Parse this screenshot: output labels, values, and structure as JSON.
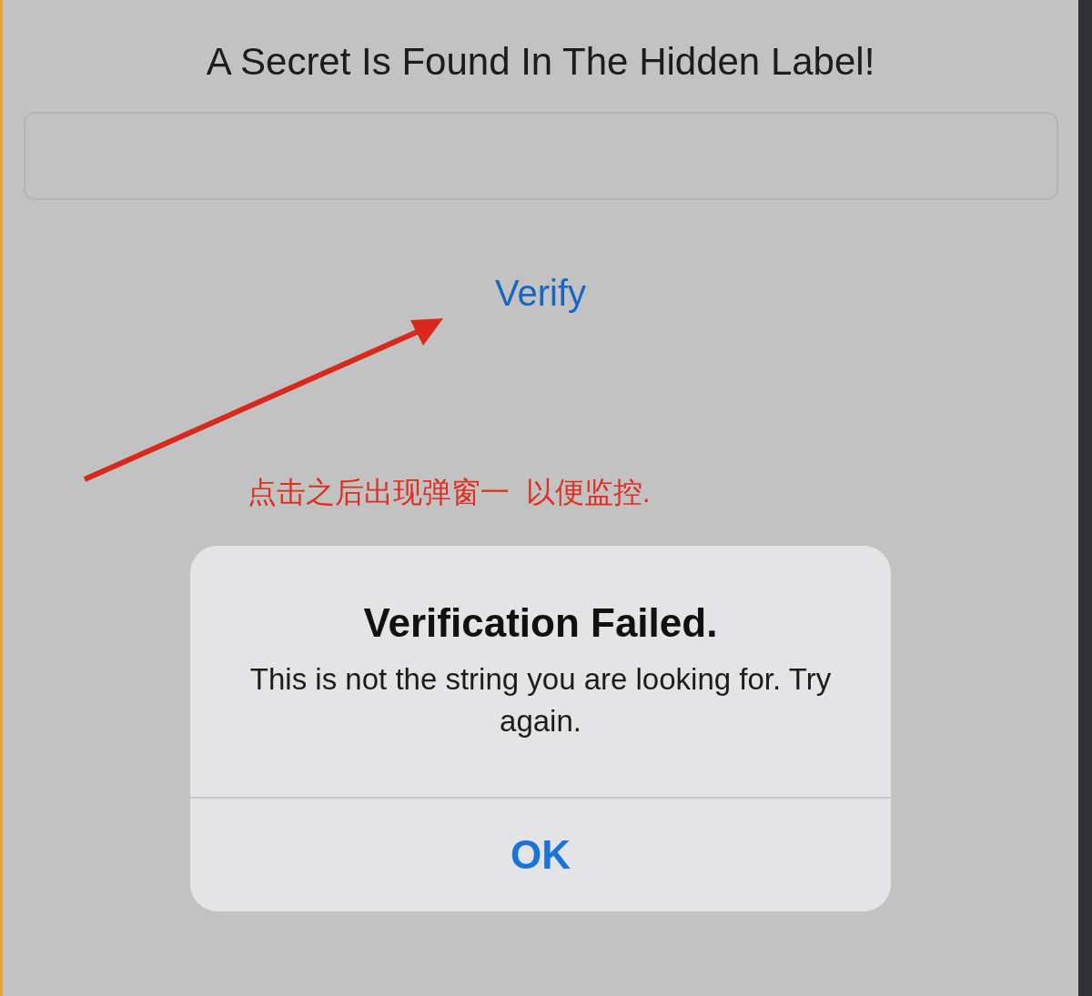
{
  "title": "A Secret Is Found In The Hidden Label!",
  "verify_button": {
    "label": "Verify"
  },
  "annotation": {
    "text": "点击之后出现弹窗一  以便监控."
  },
  "alert": {
    "title": "Verification Failed.",
    "message": "This is not the string you are looking for. Try again.",
    "buttons": [
      "OK"
    ]
  }
}
